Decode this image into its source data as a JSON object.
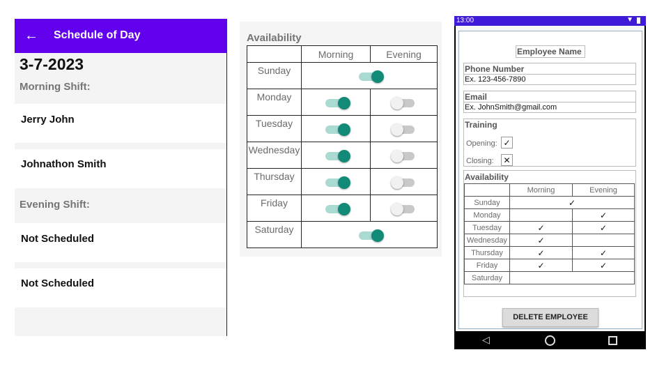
{
  "schedule": {
    "title": "Schedule of Day",
    "back_icon": "arrow-back-icon",
    "date": "3-7-2023",
    "morning_label": "Morning Shift:",
    "evening_label": "Evening Shift:",
    "morning": [
      "Jerry John",
      "Johnathon Smith"
    ],
    "evening": [
      "Not Scheduled",
      "Not Scheduled"
    ],
    "colors": {
      "appbar": "#6200ee",
      "background": "#f4f4f4"
    }
  },
  "availability_panel": {
    "heading": "Availability",
    "col_morning": "Morning",
    "col_evening": "Evening",
    "days": [
      "Sunday",
      "Monday",
      "Tuesday",
      "Wednesday",
      "Thursday",
      "Friday",
      "Saturday"
    ],
    "switch_colors": {
      "on_track": "#a9dbd3",
      "on_knob": "#138a78",
      "off_track": "#c9c9c9",
      "off_knob": "#f1f1f1"
    }
  },
  "phone": {
    "status_time": "13:00",
    "employee_name_label": "Employee Name",
    "phone_label": "Phone Number",
    "phone_placeholder": "Ex. 123-456-7890",
    "email_label": "Email",
    "email_placeholder": "Ex. JohnSmith@gmail.com",
    "training_label": "Training",
    "opening_label": "Opening:",
    "closing_label": "Closing:",
    "availability_label": "Availability",
    "col_morning": "Morning",
    "col_evening": "Evening",
    "days": [
      "Sunday",
      "Monday",
      "Tuesday",
      "Wednesday",
      "Thursday",
      "Friday",
      "Saturday"
    ],
    "delete_button": "DELETE EMPLOYEE",
    "status_bar_color": "#3f1bd8"
  }
}
